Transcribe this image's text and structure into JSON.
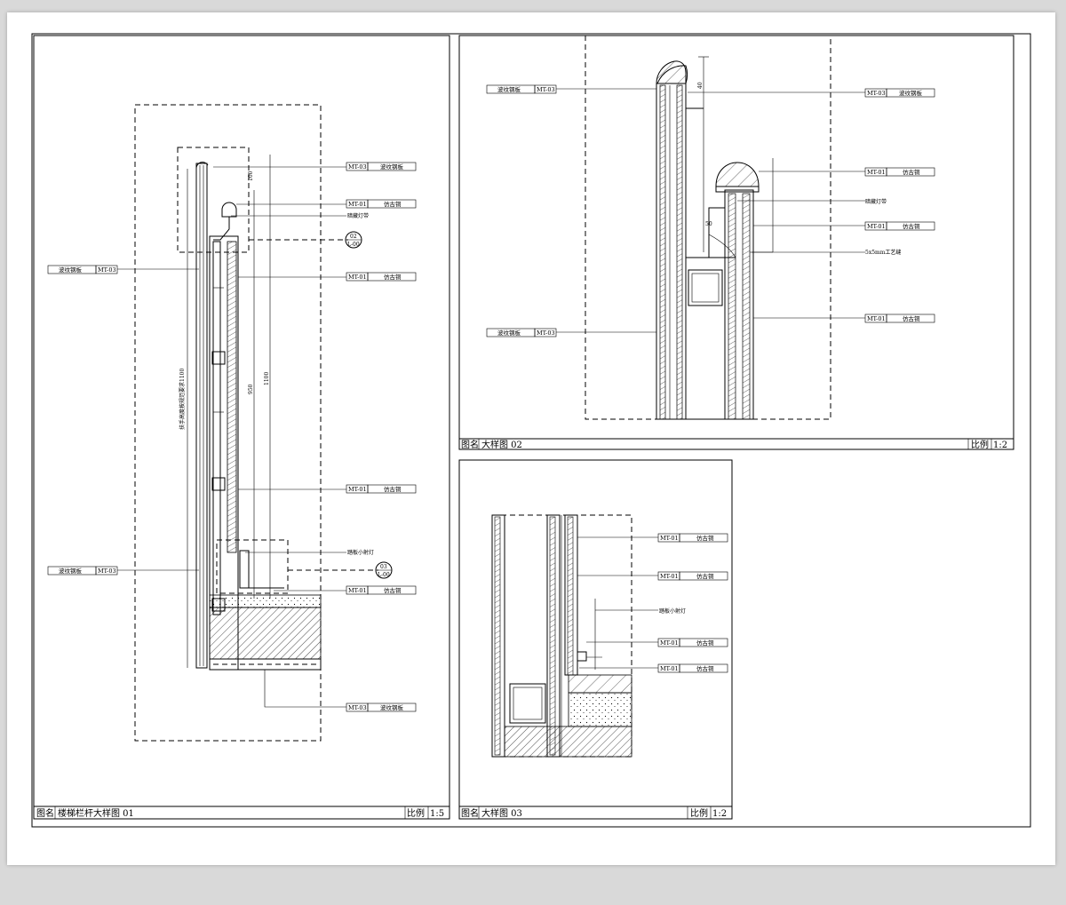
{
  "panels": [
    {
      "name_label": "图名",
      "title": "楼梯栏杆大样图 01",
      "scale_label": "比例",
      "scale": "1:5"
    },
    {
      "name_label": "图名",
      "title": "大样图 02",
      "scale_label": "比例",
      "scale": "1:2"
    },
    {
      "name_label": "图名",
      "title": "大样图 03",
      "scale_label": "比例",
      "scale": "1:2"
    }
  ],
  "tags": {
    "mt03": "MT-03",
    "mt01": "MT-01",
    "mat_wave": "波纹钢板",
    "mat_bronze": "仿古铜"
  },
  "notes": {
    "hidden_light": "暗藏灯带",
    "step_light": "踏板小射灯",
    "hidden_light_2": "暗藏灯带",
    "gap": "5x5mm工艺缝",
    "step_light_3": "踏板小射灯",
    "rail_dim": "扶手高度按规范要求1100",
    "dim_100": "100",
    "dim_950": "950",
    "dim_1100": "1100",
    "dim_40": "40",
    "dim_50": "50",
    "ref_a_top": "02",
    "ref_a_bot": "L-00",
    "ref_b_top": "03",
    "ref_b_bot": "L-00"
  }
}
